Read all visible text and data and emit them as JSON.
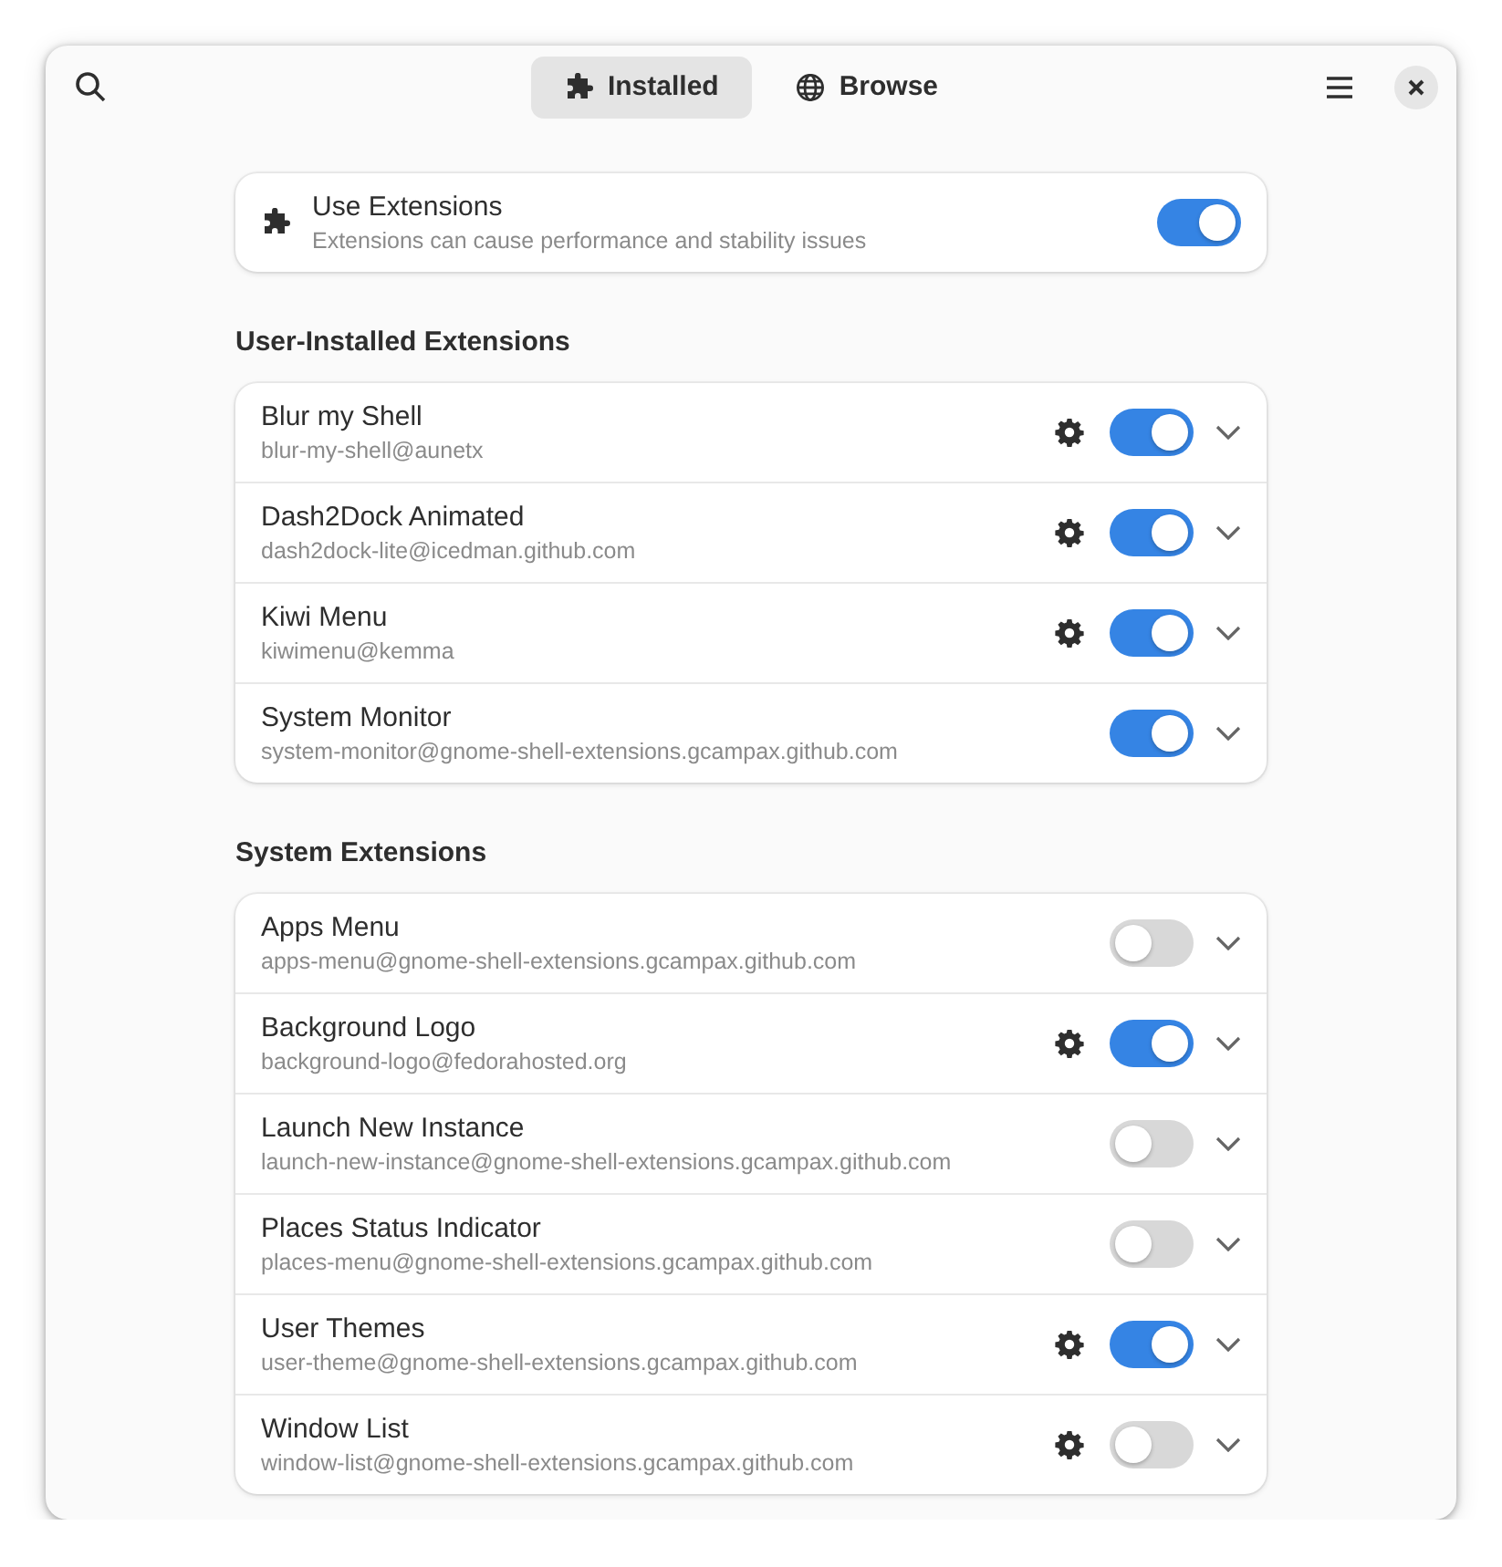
{
  "tabs": [
    {
      "label": "Installed",
      "selected": true
    },
    {
      "label": "Browse",
      "selected": false
    }
  ],
  "use_extensions": {
    "title": "Use Extensions",
    "subtitle": "Extensions can cause performance and stability issues",
    "on": true
  },
  "sections": [
    {
      "title": "User-Installed Extensions",
      "extensions": [
        {
          "name": "Blur my Shell",
          "id": "blur-my-shell@aunetx",
          "has_settings": true,
          "on": true
        },
        {
          "name": "Dash2Dock Animated",
          "id": "dash2dock-lite@icedman.github.com",
          "has_settings": true,
          "on": true
        },
        {
          "name": "Kiwi Menu",
          "id": "kiwimenu@kemma",
          "has_settings": true,
          "on": true
        },
        {
          "name": "System Monitor",
          "id": "system-monitor@gnome-shell-extensions.gcampax.github.com",
          "has_settings": false,
          "on": true
        }
      ]
    },
    {
      "title": "System Extensions",
      "extensions": [
        {
          "name": "Apps Menu",
          "id": "apps-menu@gnome-shell-extensions.gcampax.github.com",
          "has_settings": false,
          "on": false
        },
        {
          "name": "Background Logo",
          "id": "background-logo@fedorahosted.org",
          "has_settings": true,
          "on": true
        },
        {
          "name": "Launch New Instance",
          "id": "launch-new-instance@gnome-shell-extensions.gcampax.github.com",
          "has_settings": false,
          "on": false
        },
        {
          "name": "Places Status Indicator",
          "id": "places-menu@gnome-shell-extensions.gcampax.github.com",
          "has_settings": false,
          "on": false
        },
        {
          "name": "User Themes",
          "id": "user-theme@gnome-shell-extensions.gcampax.github.com",
          "has_settings": true,
          "on": true
        },
        {
          "name": "Window List",
          "id": "window-list@gnome-shell-extensions.gcampax.github.com",
          "has_settings": true,
          "on": false
        }
      ]
    }
  ]
}
